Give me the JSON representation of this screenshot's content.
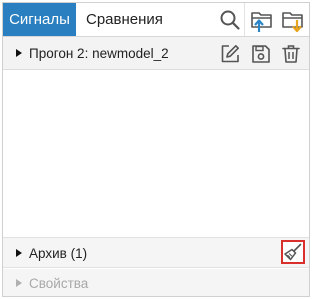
{
  "tabs": [
    {
      "label": "Сигналы",
      "active": true
    },
    {
      "label": "Сравнения",
      "active": false
    }
  ],
  "toolbar": {
    "icons": [
      "search-icon",
      "folder-upload-icon",
      "folder-download-icon"
    ]
  },
  "run": {
    "label": "Прогон 2: newmodel_2",
    "icons": [
      "edit-icon",
      "save-icon",
      "trash-icon"
    ]
  },
  "archive": {
    "label": "Архив",
    "count": "(1)",
    "icon": "broom-icon"
  },
  "properties": {
    "label": "Свойства"
  },
  "colors": {
    "accent": "#2a7fc0",
    "highlight_border": "#d9302e",
    "folder_up_arrow": "#2b86c8",
    "folder_down_arrow": "#e7a41c",
    "disabled_text": "#a8a8a8"
  }
}
